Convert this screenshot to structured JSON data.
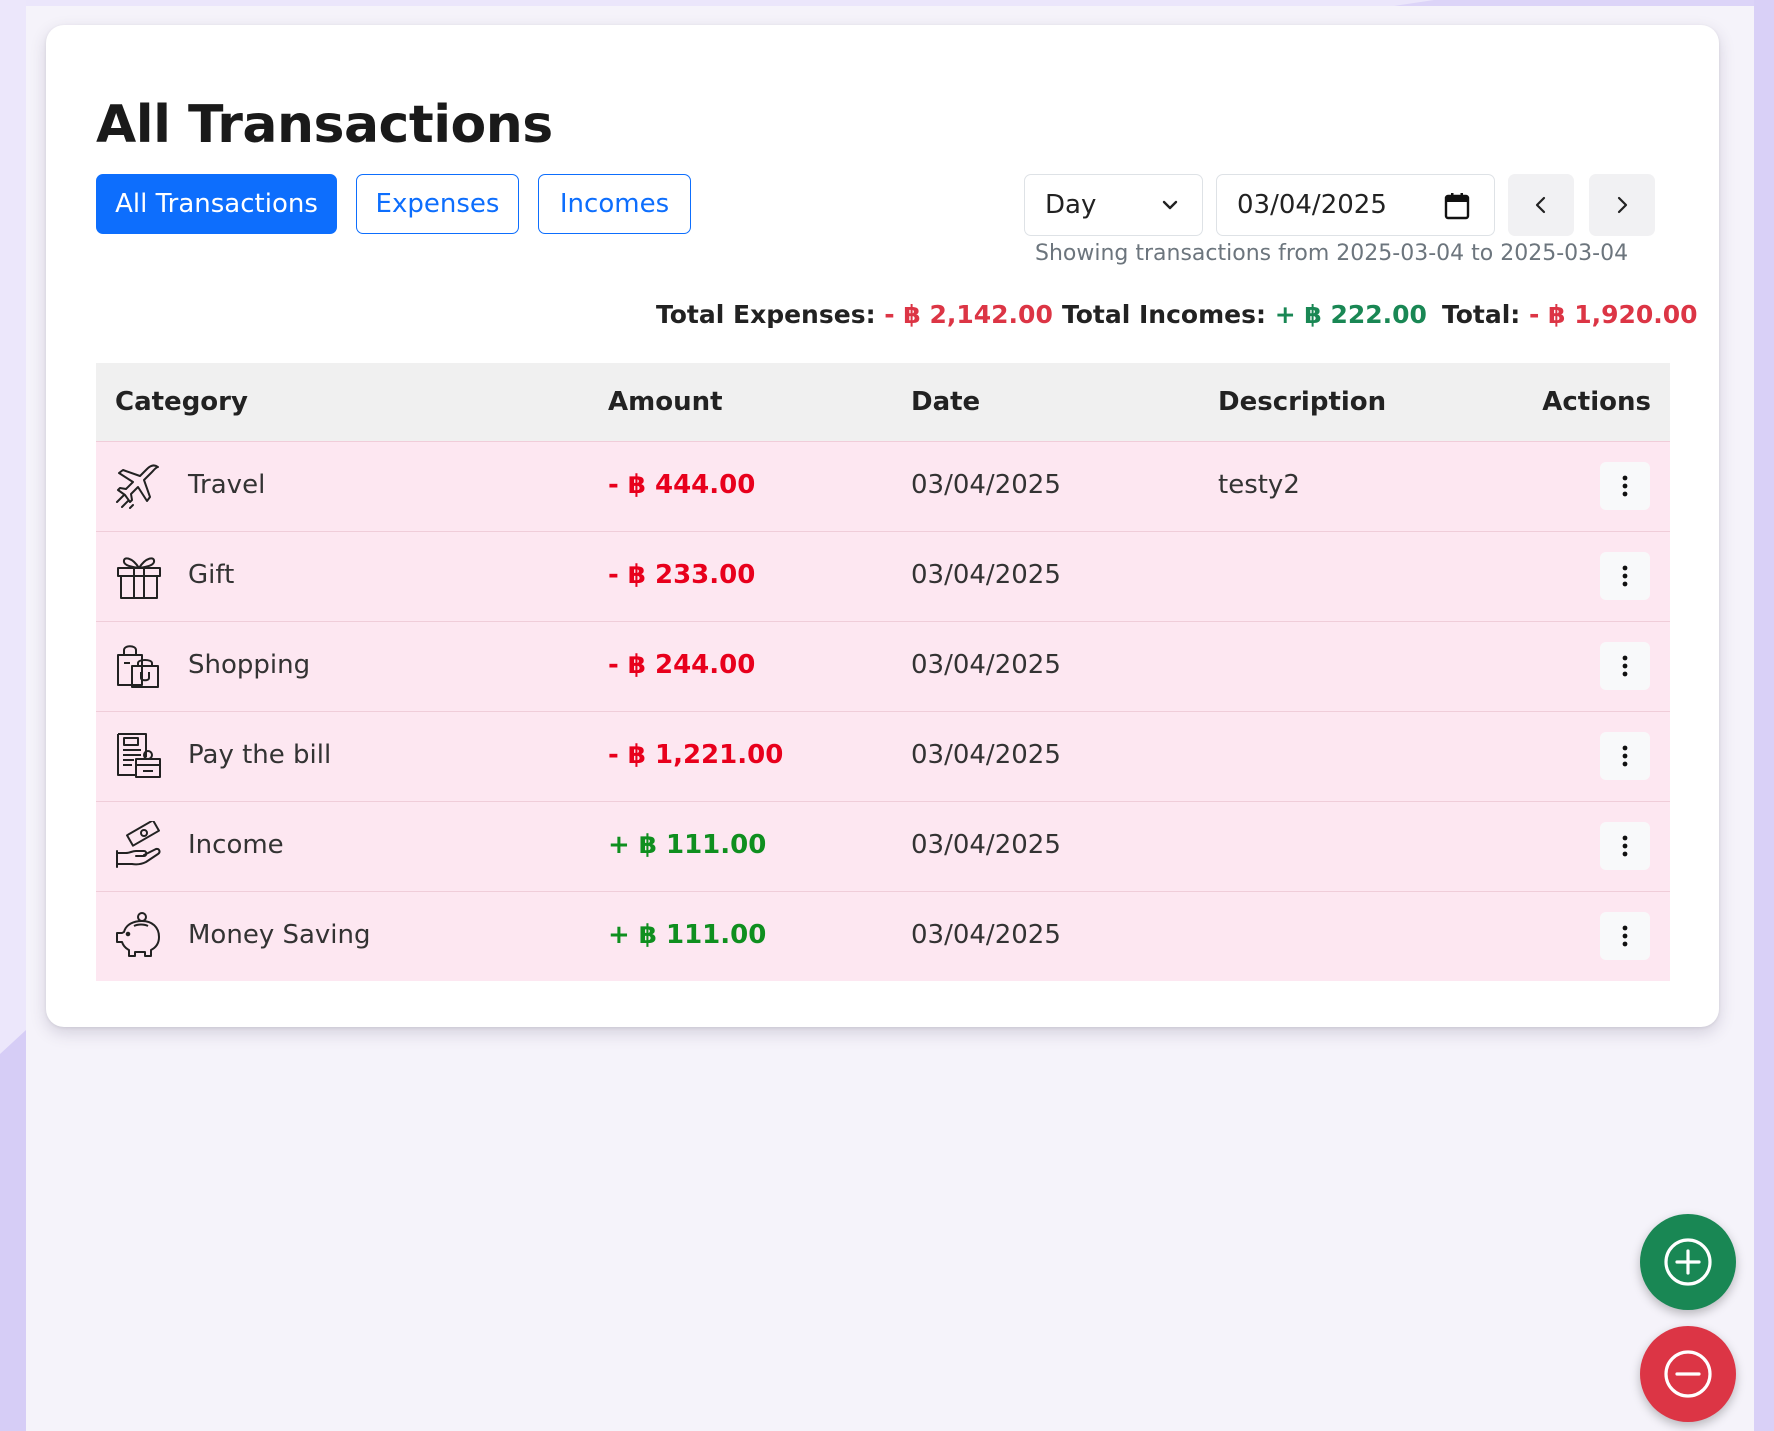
{
  "page": {
    "title": "All Transactions"
  },
  "filters": {
    "all_label": "All Transactions",
    "expenses_label": "Expenses",
    "incomes_label": "Incomes",
    "active": "All Transactions"
  },
  "period": {
    "selected": "Day",
    "date_value": "03/04/2025",
    "range_text": "Showing transactions from 2025-03-04 to 2025-03-04"
  },
  "totals": {
    "expenses_label": "Total Expenses:",
    "expenses_value": "- ฿ 2,142.00",
    "incomes_label": "Total Incomes:",
    "incomes_value": "+ ฿ 222.00",
    "total_label": "Total:",
    "total_value": "- ฿ 1,920.00"
  },
  "table": {
    "headers": [
      "Category",
      "Amount",
      "Date",
      "Description",
      "Actions"
    ],
    "rows": [
      {
        "icon": "airplane-icon",
        "category": "Travel",
        "amount": "- ฿ 444.00",
        "type": "expense",
        "date": "03/04/2025",
        "description": "testy2"
      },
      {
        "icon": "gift-icon",
        "category": "Gift",
        "amount": "- ฿ 233.00",
        "type": "expense",
        "date": "03/04/2025",
        "description": ""
      },
      {
        "icon": "shopping-bags-icon",
        "category": "Shopping",
        "amount": "- ฿ 244.00",
        "type": "expense",
        "date": "03/04/2025",
        "description": ""
      },
      {
        "icon": "bill-icon",
        "category": "Pay the bill",
        "amount": "- ฿ 1,221.00",
        "type": "expense",
        "date": "03/04/2025",
        "description": ""
      },
      {
        "icon": "hand-money-icon",
        "category": "Income",
        "amount": "+ ฿ 111.00",
        "type": "income",
        "date": "03/04/2025",
        "description": ""
      },
      {
        "icon": "piggy-bank-icon",
        "category": "Money Saving",
        "amount": "+ ฿ 111.00",
        "type": "income",
        "date": "03/04/2025",
        "description": ""
      }
    ]
  },
  "colors": {
    "primary": "#0d6efd",
    "expense": "#e8001c",
    "income": "#0f8f1f",
    "row_bg": "#fde7f1",
    "fab_add": "#198754",
    "fab_subtract": "#dc3545"
  }
}
